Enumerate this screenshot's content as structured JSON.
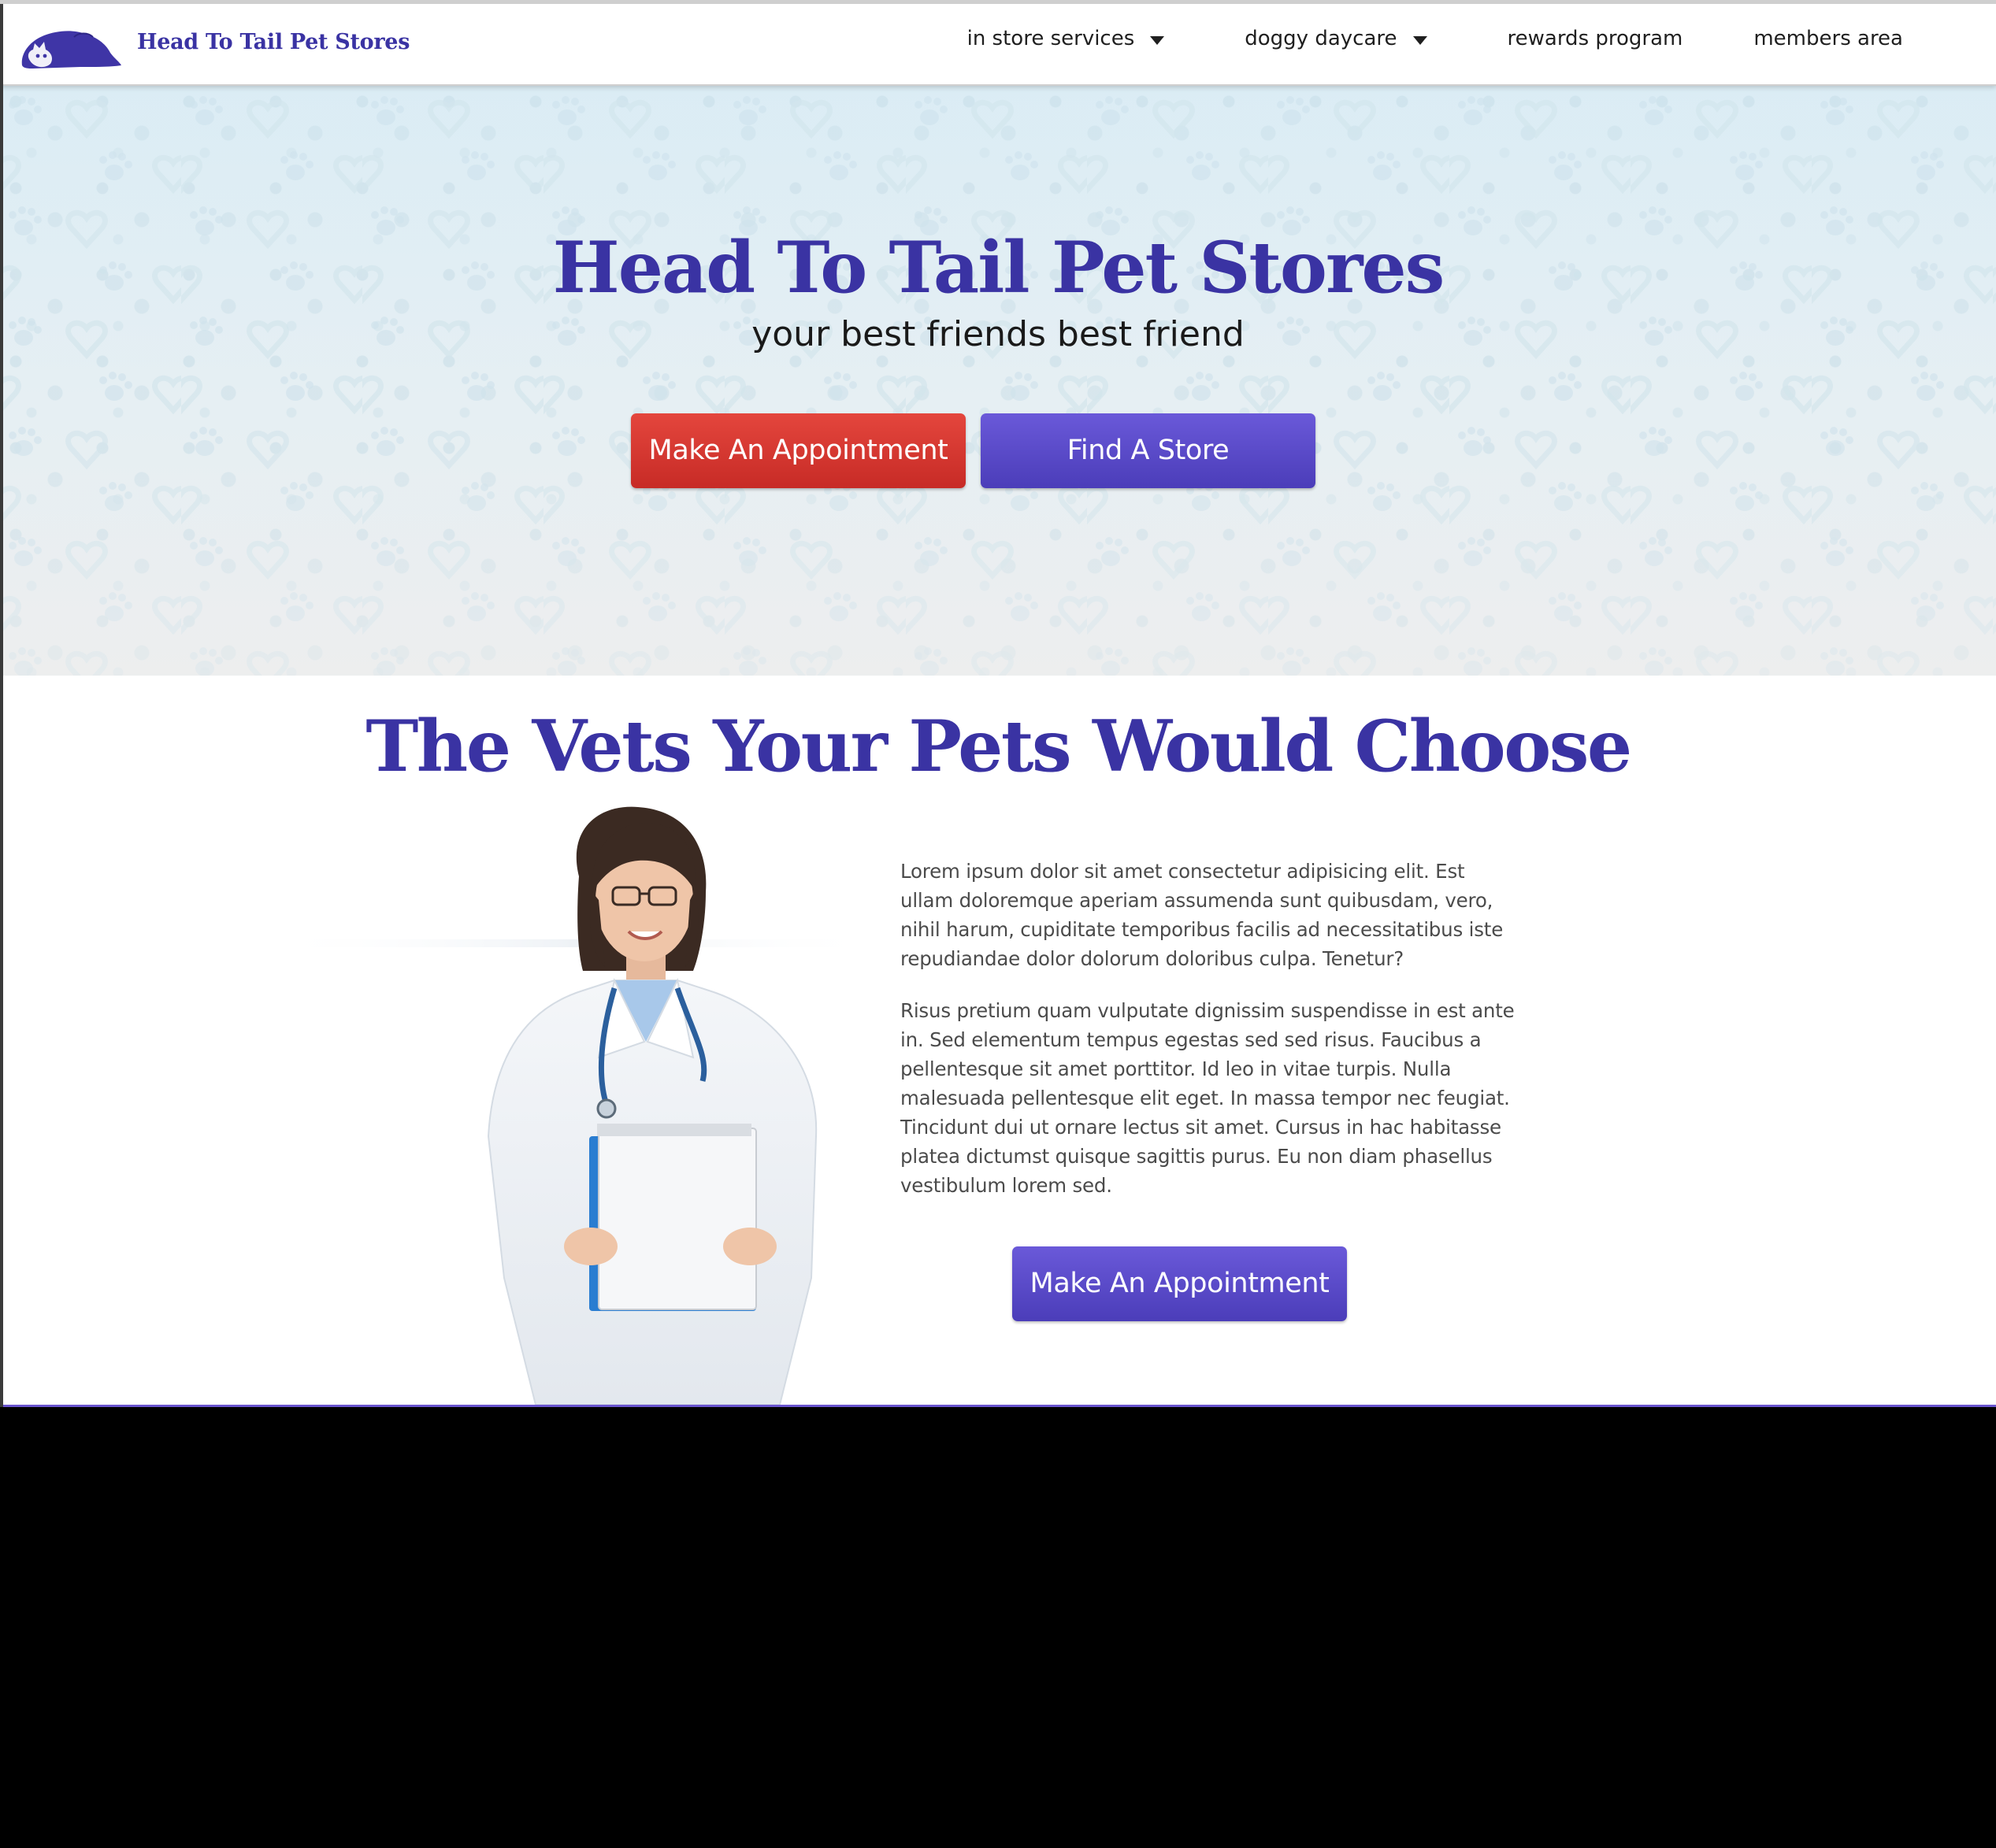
{
  "header": {
    "brand_name": "Head To Tail Pet Stores",
    "nav": {
      "services": "in store services",
      "daycare": "doggy daycare",
      "rewards": "rewards program",
      "members": "members area"
    }
  },
  "hero": {
    "title": "Head To Tail Pet Stores",
    "tagline": "your best friends best friend",
    "appointment_label": "Make An Appointment",
    "store_label": "Find A Store"
  },
  "vets": {
    "heading": "The Vets Your Pets Would Choose",
    "paragraphs": [
      "Lorem ipsum dolor sit amet consectetur adipisicing elit. Est ullam doloremque aperiam assumenda sunt quibusdam, vero, nihil harum, cupiditate temporibus facilis ad necessitatibus iste repudiandae dolor dolorum doloribus culpa. Tenetur?",
      "Risus pretium quam vulputate dignissim suspendisse in est ante in. Sed elementum tempus egestas sed sed risus. Faucibus a pellentesque sit amet porttitor. Id leo in vitae turpis. Nulla malesuada pellentesque elit eget. In massa tempor nec feugiat. Tincidunt dui ut ornare lectus sit amet. Cursus in hac habitasse platea dictumst quisque sagittis purus. Eu non diam phasellus vestibulum lorem sed."
    ],
    "appointment_label": "Make An Appointment"
  },
  "colors": {
    "brand_purple": "#3a33a3",
    "button_red": "#d1342e",
    "button_purple": "#5a4ac9"
  }
}
